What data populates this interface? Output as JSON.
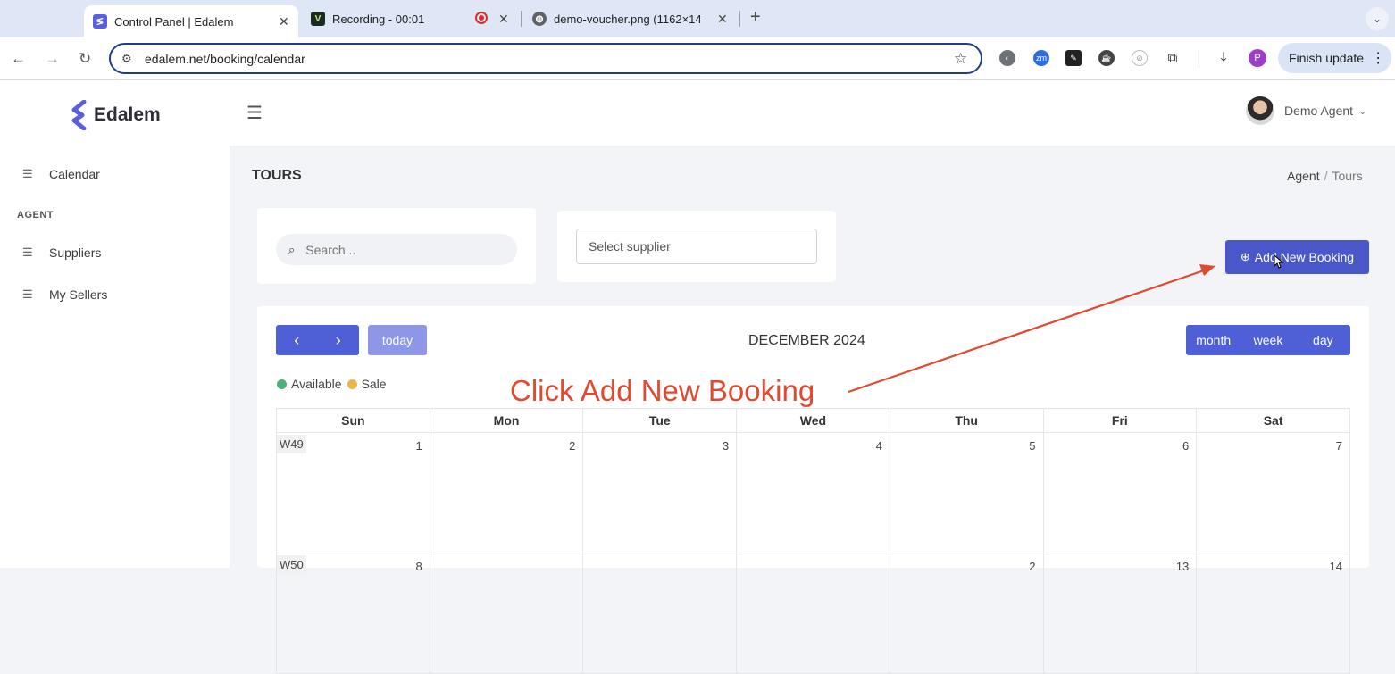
{
  "browser": {
    "tabs": [
      {
        "title": "Control Panel | Edalem",
        "favicon": "edalem-logo"
      },
      {
        "title": "Recording - 00:01",
        "favicon": "v-logo"
      },
      {
        "title": "demo-voucher.png (1162×14",
        "favicon": "globe-icon"
      }
    ],
    "url": "edalem.net/booking/calendar",
    "finish_update": "Finish update",
    "profile_initial": "P",
    "zm_label": "zm"
  },
  "app": {
    "logo_text": "Edalem",
    "user_name": "Demo Agent",
    "brand_color": "#4a57c8"
  },
  "sidebar": {
    "calendar": "Calendar",
    "section": "AGENT",
    "suppliers": "Suppliers",
    "sellers": "My Sellers"
  },
  "page": {
    "title": "TOURS",
    "breadcrumb_parent": "Agent",
    "breadcrumb_sep": "/",
    "breadcrumb_current": "Tours",
    "search_placeholder": "Search...",
    "select_placeholder": "Select supplier",
    "add_button": "Add New Booking"
  },
  "calendar": {
    "title": "DECEMBER 2024",
    "today": "today",
    "views": [
      "month",
      "week",
      "day"
    ],
    "legend": [
      {
        "label": "Available",
        "color": "#4caf7d"
      },
      {
        "label": "Sale",
        "color": "#e8b64a"
      }
    ],
    "weekdays": [
      "Sun",
      "Mon",
      "Tue",
      "Wed",
      "Thu",
      "Fri",
      "Sat"
    ],
    "weeks": [
      {
        "label": "W49",
        "days": [
          "1",
          "2",
          "3",
          "4",
          "5",
          "6",
          "7"
        ]
      },
      {
        "label": "W50",
        "days": [
          "8",
          "",
          "",
          "",
          "2",
          "13",
          "14"
        ]
      }
    ]
  },
  "annotation": {
    "text": "Click Add New Booking",
    "color": "#e04a2e"
  }
}
